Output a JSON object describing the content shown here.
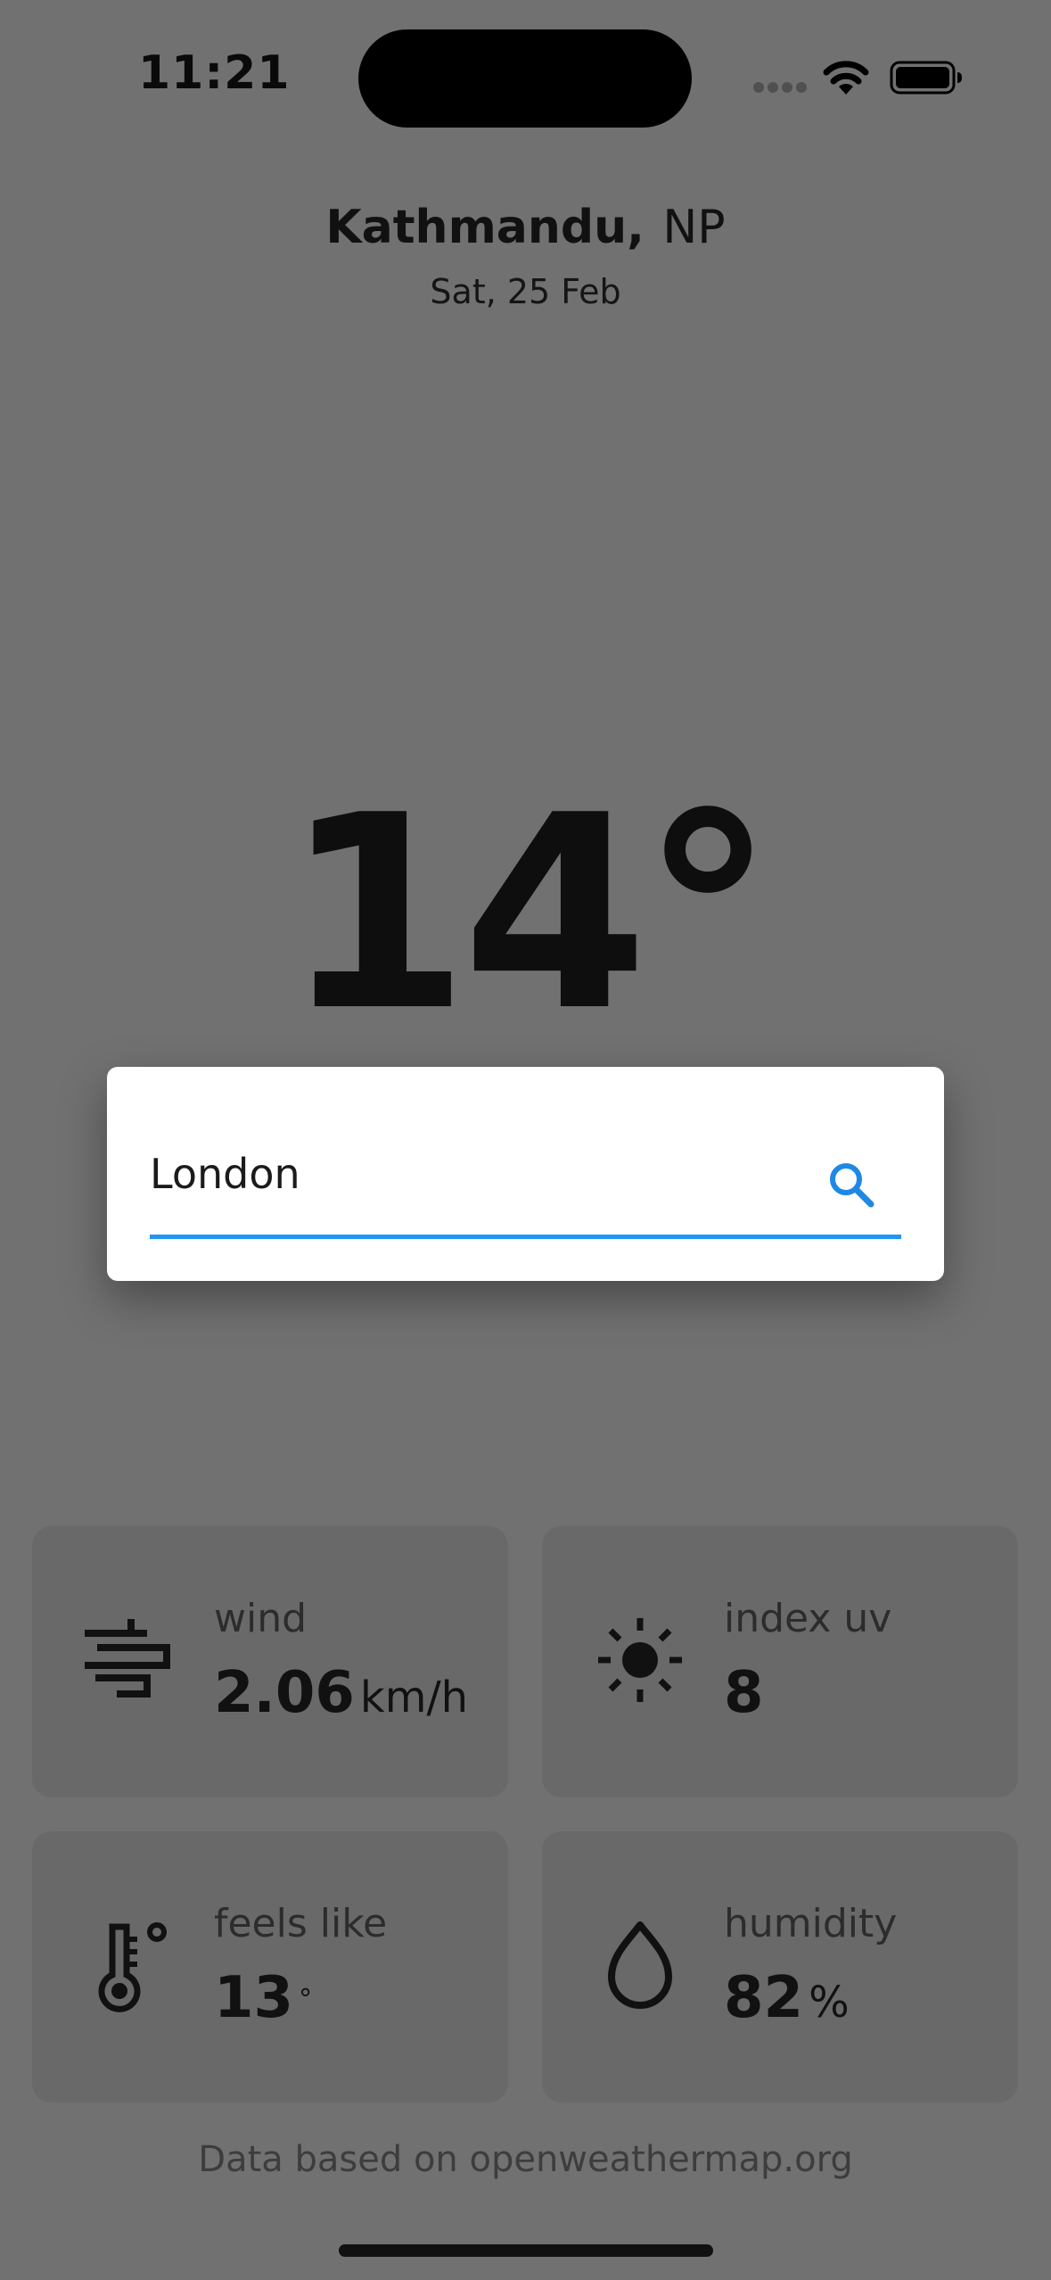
{
  "status_bar": {
    "time": "11:21"
  },
  "header": {
    "city": "Kathmandu,",
    "country": "NP",
    "date": "Sat, 25 Feb"
  },
  "current": {
    "temperature": "14°"
  },
  "search": {
    "value": "London",
    "accent_color": "#2196f3"
  },
  "cards": [
    {
      "label": "wind",
      "value": "2.06",
      "unit": "km/h",
      "icon": "wind-icon"
    },
    {
      "label": "index uv",
      "value": "8",
      "unit": "",
      "icon": "sun-icon"
    },
    {
      "label": "feels like",
      "value": "13",
      "unit": "°",
      "icon": "thermometer-icon"
    },
    {
      "label": "humidity",
      "value": "82",
      "unit": "%",
      "icon": "droplet-icon"
    }
  ],
  "footer": {
    "text": "Data based on openweathermap.org"
  }
}
